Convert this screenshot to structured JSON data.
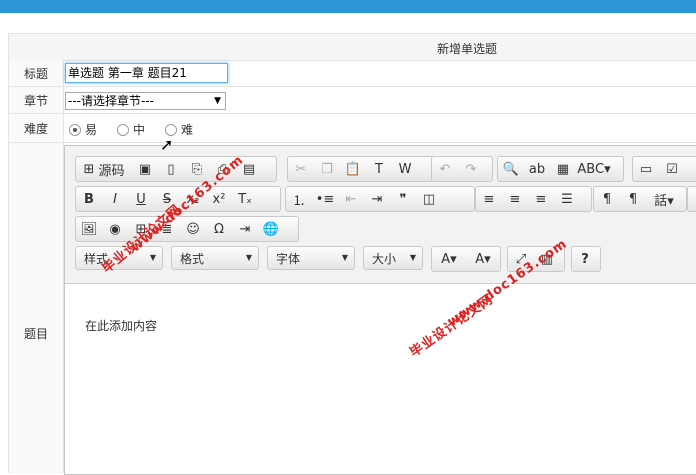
{
  "form": {
    "title": "新增单选题",
    "labels": {
      "title": "标题",
      "chapter": "章节",
      "difficulty": "难度",
      "question": "题目"
    },
    "title_value": "单选题 第一章 题目21",
    "chapter_selected": "---请选择章节---",
    "difficulty_options": [
      "易",
      "中",
      "难"
    ],
    "difficulty_selected": "易"
  },
  "editor": {
    "source_label": "源码",
    "combos": [
      "样式",
      "格式",
      "字体",
      "大小"
    ],
    "content": "在此添加内容"
  },
  "watermarks": [
    "毕业设计论文网",
    "www.doc163.com",
    "毕业设计论文网",
    "www.doc163.com"
  ],
  "colors": {
    "accent": "#2b97d6",
    "focus": "#66afe9",
    "watermark": "#dd2222"
  }
}
